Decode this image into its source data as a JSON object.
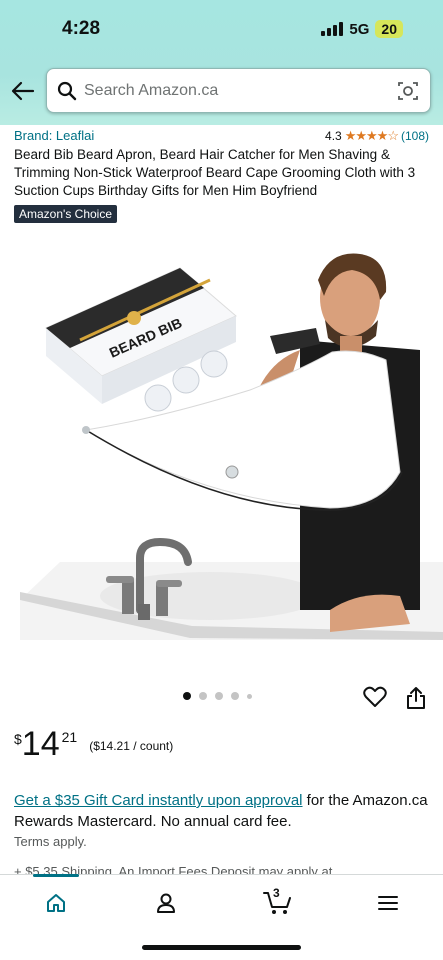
{
  "status_bar": {
    "time": "4:28",
    "network": "5G",
    "battery": "20"
  },
  "search": {
    "placeholder": "Search Amazon.ca"
  },
  "product": {
    "brand": "Brand: Leaflai",
    "rating": "4.3",
    "rating_count": "(108)",
    "title": "Beard Bib Beard Apron, Beard Hair Catcher for Men Shaving & Trimming Non-Stick Waterproof Beard Cape Grooming Cloth with 3 Suction Cups Birthday Gifts for Men Him Boyfriend",
    "badge": "Amazon's Choice",
    "box_label": "BEARD BIB"
  },
  "carousel": {
    "total": 5,
    "active_index": 0
  },
  "price": {
    "symbol": "$",
    "whole": "14",
    "fraction": "21",
    "unit": "($14.21 / count)"
  },
  "promo": {
    "link_text": "Get a $35 Gift Card instantly upon approval",
    "rest_text": " for the Amazon.ca Rewards Mastercard. No annual card fee.",
    "terms": "Terms apply."
  },
  "shipping": "+ $5.35 Shipping. An Import Fees Deposit may apply at",
  "bottom_nav": {
    "cart_count": "3"
  },
  "colors": {
    "header": "#a8e4df",
    "link": "#007185",
    "star": "#de7921",
    "badge_bg": "#232f3e"
  }
}
